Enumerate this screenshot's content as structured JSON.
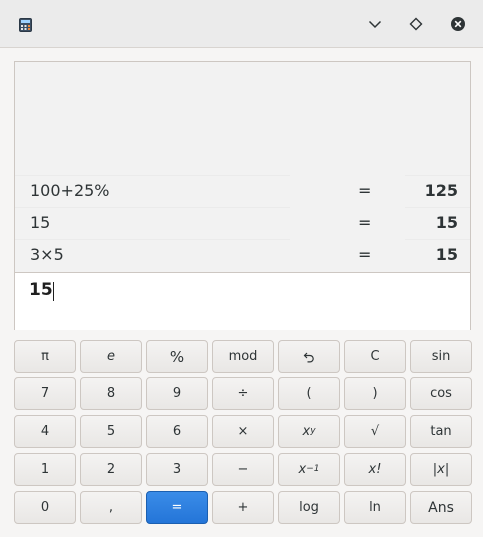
{
  "window": {
    "icon": "calculator-icon",
    "buttons": [
      "chevron-down-icon",
      "diamond-icon",
      "close-icon"
    ]
  },
  "history": [
    {
      "expression": "100+25%",
      "equals": "=",
      "result": "125"
    },
    {
      "expression": "15",
      "equals": "=",
      "result": "15"
    },
    {
      "expression": "3×5",
      "equals": "=",
      "result": "15"
    }
  ],
  "entry": {
    "value": "15"
  },
  "keypad": {
    "pi": "π",
    "e": "e",
    "percent": "%",
    "mod": "mod",
    "undo": "↶",
    "clear": "C",
    "sin": "sin",
    "d7": "7",
    "d8": "8",
    "d9": "9",
    "divide": "÷",
    "lparen": "(",
    "rparen": ")",
    "cos": "cos",
    "d4": "4",
    "d5": "5",
    "d6": "6",
    "multiply": "×",
    "power_base": "x",
    "power_exp": "y",
    "sqrt": "√",
    "tan": "tan",
    "d1": "1",
    "d2": "2",
    "d3": "3",
    "minus": "−",
    "inverse_base": "x",
    "inverse_exp": "−1",
    "factorial": "x!",
    "abs": "|x|",
    "d0": "0",
    "comma": ",",
    "equals": "=",
    "plus": "+",
    "log": "log",
    "ln": "ln",
    "ans": "Ans"
  },
  "colors": {
    "accent": "#2a7de1",
    "background": "#f6f5f4"
  }
}
